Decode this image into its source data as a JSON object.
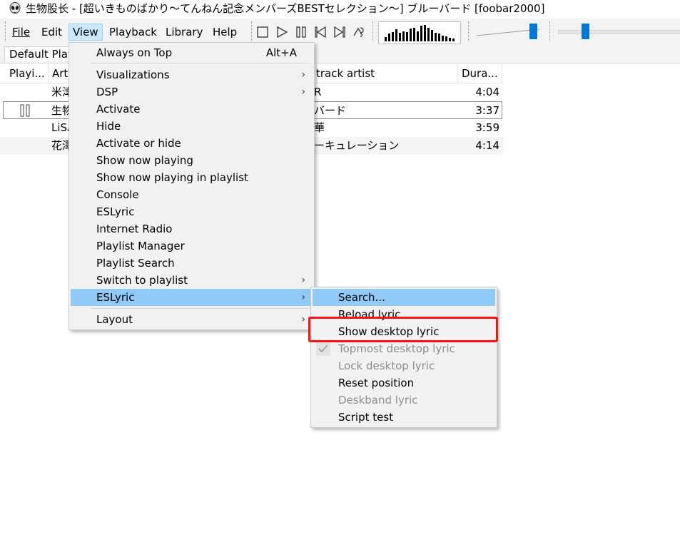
{
  "window": {
    "title": "生物股长 - [超いきものばかり〜てんねん記念メンバーズBESTセレクション〜] ブルーバード  [foobar2000]"
  },
  "menubar": {
    "items": [
      {
        "label": "File"
      },
      {
        "label": "Edit"
      },
      {
        "label": "View"
      },
      {
        "label": "Playback"
      },
      {
        "label": "Library"
      },
      {
        "label": "Help"
      }
    ]
  },
  "toolbar": {
    "icons": [
      "stop-icon",
      "play-icon",
      "pause-icon",
      "previous-icon",
      "next-icon",
      "random-icon"
    ],
    "volume_level": 0.85,
    "seek_position": 0.2,
    "visualizer_levels": [
      0.25,
      0.45,
      0.55,
      0.7,
      0.5,
      0.6,
      0.55,
      0.75,
      0.8,
      0.6,
      0.9,
      0.95,
      0.8,
      0.65,
      0.5,
      0.45,
      0.35,
      0.3,
      0.2,
      0.15
    ]
  },
  "playlist_tabs": {
    "active": "Default Play"
  },
  "columns": {
    "playing": "Playi...",
    "artist": "Art",
    "track_artist": "track artist",
    "duration": "Dura..."
  },
  "rows": [
    {
      "artist": "米津",
      "title_fragment": "R",
      "duration": "4:04",
      "playing": ""
    },
    {
      "artist": "生物",
      "title_fragment": "バード",
      "duration": "3:37",
      "playing": "pause"
    },
    {
      "artist": "LiSA",
      "title_fragment": "華",
      "duration": "3:59",
      "playing": ""
    },
    {
      "artist": "花澤",
      "title_fragment": "ーキュレーション",
      "duration": "4:14",
      "playing": ""
    }
  ],
  "view_menu": {
    "items": [
      {
        "label": "Always on Top",
        "accel": "Alt+A"
      },
      {
        "label": "Visualizations",
        "submenu": true
      },
      {
        "label": "DSP",
        "submenu": true
      },
      {
        "label": "Activate"
      },
      {
        "label": "Hide"
      },
      {
        "label": "Activate or hide"
      },
      {
        "label": "Show now playing"
      },
      {
        "label": "Show now playing in playlist"
      },
      {
        "label": "Console"
      },
      {
        "label": "ESLyric"
      },
      {
        "label": "Internet Radio"
      },
      {
        "label": "Playlist Manager"
      },
      {
        "label": "Playlist Search"
      },
      {
        "label": "Switch to playlist",
        "submenu": true
      },
      {
        "label": "ESLyric",
        "submenu": true,
        "highlighted": true
      },
      {
        "label": "Layout",
        "submenu": true
      }
    ]
  },
  "eslyric_submenu": {
    "items": [
      {
        "label": "Search...",
        "highlighted": true
      },
      {
        "label": "Reload lyric"
      },
      {
        "label": "Show desktop lyric"
      },
      {
        "label": "Topmost desktop lyric",
        "disabled": true,
        "checked": true
      },
      {
        "label": "Lock desktop lyric",
        "disabled": true
      },
      {
        "label": "Reset position"
      },
      {
        "label": "Deskband lyric",
        "disabled": true
      },
      {
        "label": "Script test"
      }
    ]
  },
  "colors": {
    "highlight": "#91c9f7",
    "accent": "#0078d7",
    "callout": "#ff1111"
  }
}
